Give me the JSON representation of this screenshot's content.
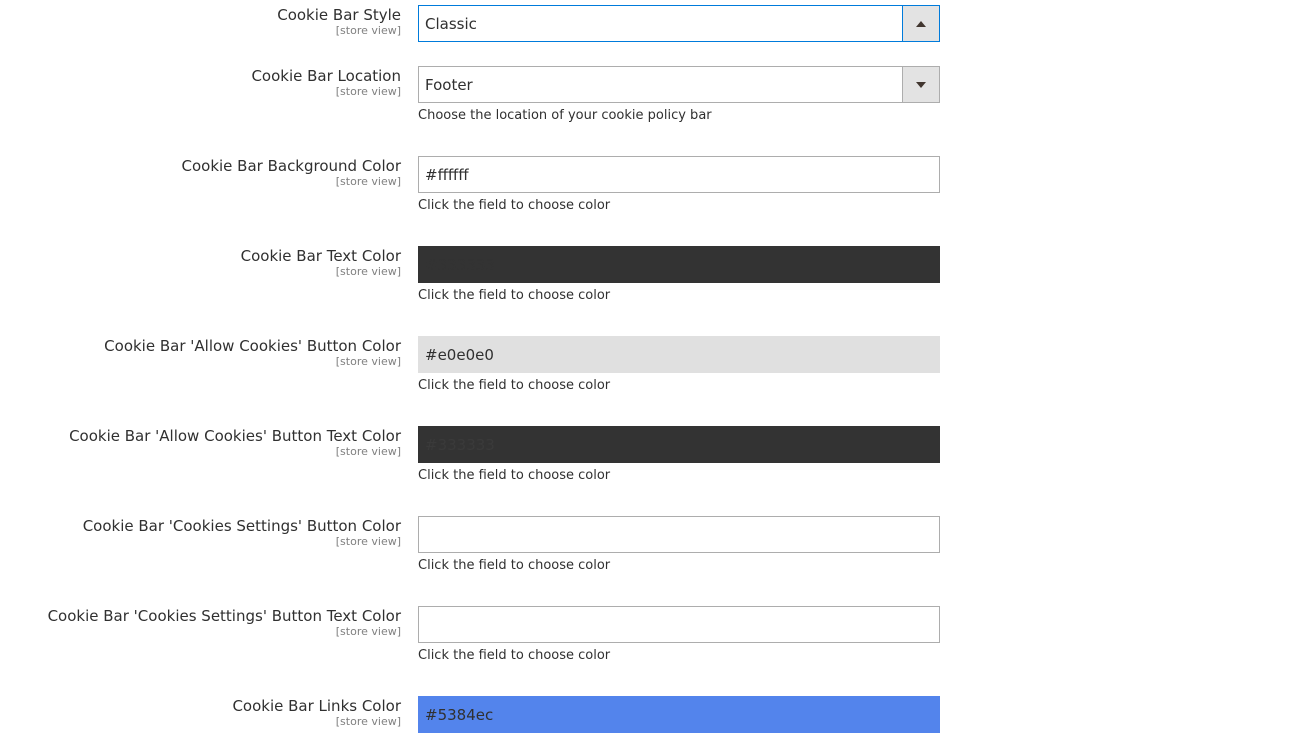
{
  "fields": [
    {
      "label": "Cookie Bar Style",
      "scope": "[store view]",
      "type": "select",
      "value": "Classic",
      "open": true
    },
    {
      "label": "Cookie Bar Location",
      "scope": "[store view]",
      "type": "select",
      "value": "Footer",
      "note": "Choose the location of your cookie policy bar"
    },
    {
      "label": "Cookie Bar Background Color",
      "scope": "[store view]",
      "type": "color",
      "value": "#ffffff",
      "swatch": "#ffffff",
      "text_color": "#303030",
      "note": "Click the field to choose color"
    },
    {
      "label": "Cookie Bar Text Color",
      "scope": "[store view]",
      "type": "color",
      "value": "#333333",
      "swatch": "#333333",
      "text_color": "#333333",
      "note": "Click the field to choose color"
    },
    {
      "label": "Cookie Bar 'Allow Cookies' Button Color",
      "scope": "[store view]",
      "type": "color",
      "value": "#e0e0e0",
      "swatch": "#e0e0e0",
      "text_color": "#303030",
      "note": "Click the field to choose color"
    },
    {
      "label": "Cookie Bar 'Allow Cookies' Button Text Color",
      "scope": "[store view]",
      "type": "color",
      "value": "#333333",
      "swatch": "#333333",
      "text_color": "#3a3a3a",
      "note": "Click the field to choose color"
    },
    {
      "label": "Cookie Bar 'Cookies Settings' Button Color",
      "scope": "[store view]",
      "type": "color",
      "value": "",
      "swatch": "#ffffff",
      "text_color": "#303030",
      "note": "Click the field to choose color"
    },
    {
      "label": "Cookie Bar 'Cookies Settings' Button Text Color",
      "scope": "[store view]",
      "type": "color",
      "value": "",
      "swatch": "#ffffff",
      "text_color": "#303030",
      "note": "Click the field to choose color"
    },
    {
      "label": "Cookie Bar Links Color",
      "scope": "[store view]",
      "type": "color",
      "value": "#5384ec",
      "swatch": "#5384ec",
      "text_color": "#303030"
    }
  ]
}
